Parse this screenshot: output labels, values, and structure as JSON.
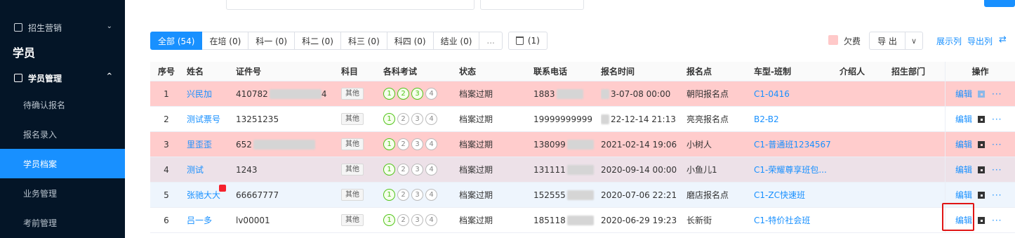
{
  "sidebar": {
    "recruit_menu": "招生营销",
    "section_title": "学员",
    "student_menu": "学员管理",
    "items": [
      {
        "label": "待确认报名"
      },
      {
        "label": "报名录入"
      },
      {
        "label": "学员档案"
      },
      {
        "label": "业务管理"
      },
      {
        "label": "考前管理"
      }
    ],
    "active_index": 2
  },
  "tabs": [
    {
      "label": "全部 (54)"
    },
    {
      "label": "在培 (0)"
    },
    {
      "label": "科一 (0)"
    },
    {
      "label": "科二 (0)"
    },
    {
      "label": "科三 (0)"
    },
    {
      "label": "科四 (0)"
    },
    {
      "label": "结业 (0)"
    },
    {
      "label": "..."
    }
  ],
  "trash_tab": "(1)",
  "toolbar": {
    "legend_label": "欠费",
    "export_label": "导 出",
    "show_columns": "展示列",
    "export_columns": "导出列"
  },
  "table": {
    "headers": [
      "序号",
      "姓名",
      "证件号",
      "科目",
      "各科考试",
      "状态",
      "联系电话",
      "报名时间",
      "报名点",
      "车型-班制",
      "介绍人",
      "招生部门",
      "操作"
    ],
    "rows": [
      {
        "no": "1",
        "name": "兴民加",
        "id": "410782",
        "id_tail": "4",
        "subject": "其他",
        "exams": [
          "1",
          "2",
          "3",
          "4"
        ],
        "passed": 3,
        "status": "档案过期",
        "phone": "1883",
        "time": "3-07-08 00:00",
        "location": "朝阳报名点",
        "class": "C1-0416",
        "row_color": "pink"
      },
      {
        "no": "2",
        "name": "测试票号",
        "id": "13251235",
        "id_tail": "",
        "subject": "其他",
        "exams": [
          "1",
          "2",
          "3",
          "4"
        ],
        "passed": 1,
        "status": "档案过期",
        "phone": "19999999999",
        "time": "22-12-14 21:13",
        "location": "亮亮报名点",
        "class": "B2-B2",
        "row_color": "white"
      },
      {
        "no": "3",
        "name": "里歪歪",
        "id": "652",
        "id_tail": "",
        "subject": "其他",
        "exams": [
          "1",
          "2",
          "3",
          "4"
        ],
        "passed": 1,
        "status": "档案过期",
        "phone": "138099",
        "time": "2021-02-14 19:06",
        "location": "小树人",
        "class": "C1-普通班1234567",
        "row_color": "pink"
      },
      {
        "no": "4",
        "name": "测试",
        "id": "1243",
        "id_tail": "",
        "subject": "其他",
        "exams": [
          "1",
          "2",
          "3",
          "4"
        ],
        "passed": 1,
        "status": "档案过期",
        "phone": "131111",
        "time": "2020-09-14 00:00",
        "location": "小鱼儿1",
        "class": "C1-荣耀尊享班包...",
        "row_color": "lavender"
      },
      {
        "no": "5",
        "name": "张驰大大",
        "id": "66667777",
        "id_tail": "",
        "subject": "其他",
        "exams": [
          "1",
          "2",
          "3",
          "4"
        ],
        "passed": 1,
        "status": "档案过期",
        "phone": "152555",
        "time": "2020-07-06 22:21",
        "location": "磨店报名点",
        "class": "C1-ZC快速班",
        "row_color": "lightblue"
      },
      {
        "no": "6",
        "name": "吕一多",
        "id": "lv00001",
        "id_tail": "",
        "subject": "其他",
        "exams": [
          "1",
          "2",
          "3",
          "4"
        ],
        "passed": 1,
        "status": "档案过期",
        "phone": "185118",
        "time": "2020-06-29 19:23",
        "location": "长新街",
        "class": "C1-特价社会班",
        "row_color": "white"
      }
    ],
    "edit_label": "编辑",
    "more_label": "···"
  },
  "colors": {
    "sidebar_bg": "#041527",
    "accent": "#1890ff",
    "arrears_row": "#ffcccc",
    "highlight": "#e01515"
  }
}
